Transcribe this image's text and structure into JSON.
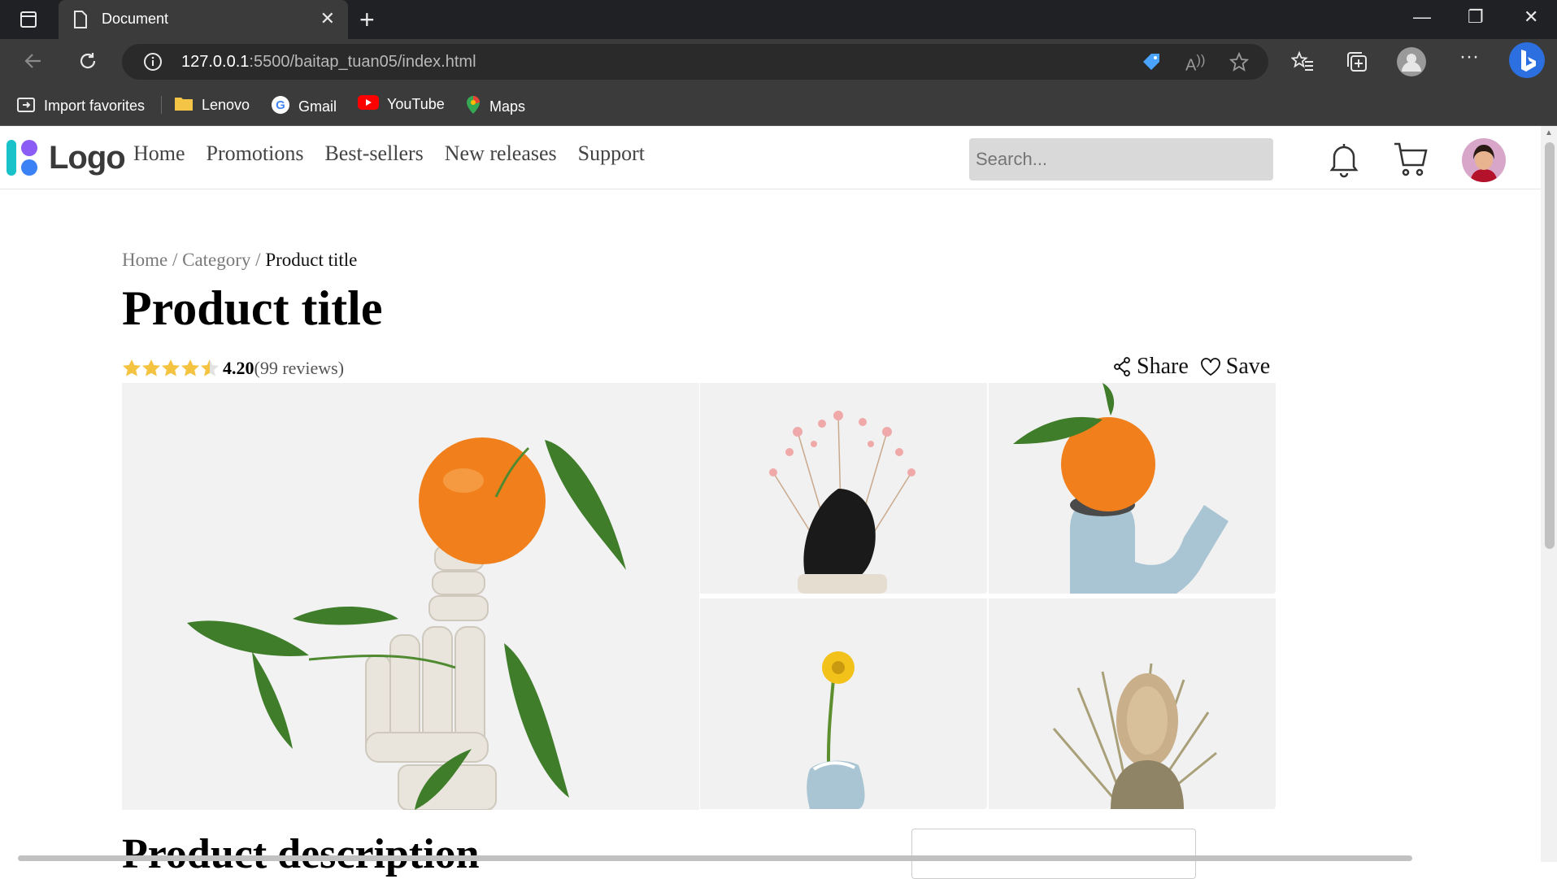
{
  "browser": {
    "tab_title": "Document",
    "url_host": "127.0.0.1",
    "url_path": ":5500/baitap_tuan05/index.html",
    "bookmarks": [
      {
        "label": "Import favorites",
        "icon": "import-icon"
      },
      {
        "label": "Lenovo",
        "icon": "folder-icon"
      },
      {
        "label": "Gmail",
        "icon": "google-icon"
      },
      {
        "label": "YouTube",
        "icon": "youtube-icon"
      },
      {
        "label": "Maps",
        "icon": "maps-icon"
      }
    ]
  },
  "header": {
    "logo_text": "Logo",
    "nav": [
      "Home",
      "Promotions",
      "Best-sellers",
      "New releases",
      "Support"
    ],
    "search_placeholder": "Search..."
  },
  "breadcrumb": {
    "home": "Home",
    "sep": "/",
    "category": "Category",
    "current": "Product title"
  },
  "product": {
    "title": "Product title",
    "rating_value": "4.20",
    "rating_stars": 4.2,
    "reviews": "(99 reviews)",
    "share_label": "Share",
    "save_label": "Save",
    "description_heading": "Product description"
  },
  "colors": {
    "accent_price": "#12c6d6",
    "star": "#f5c342"
  }
}
